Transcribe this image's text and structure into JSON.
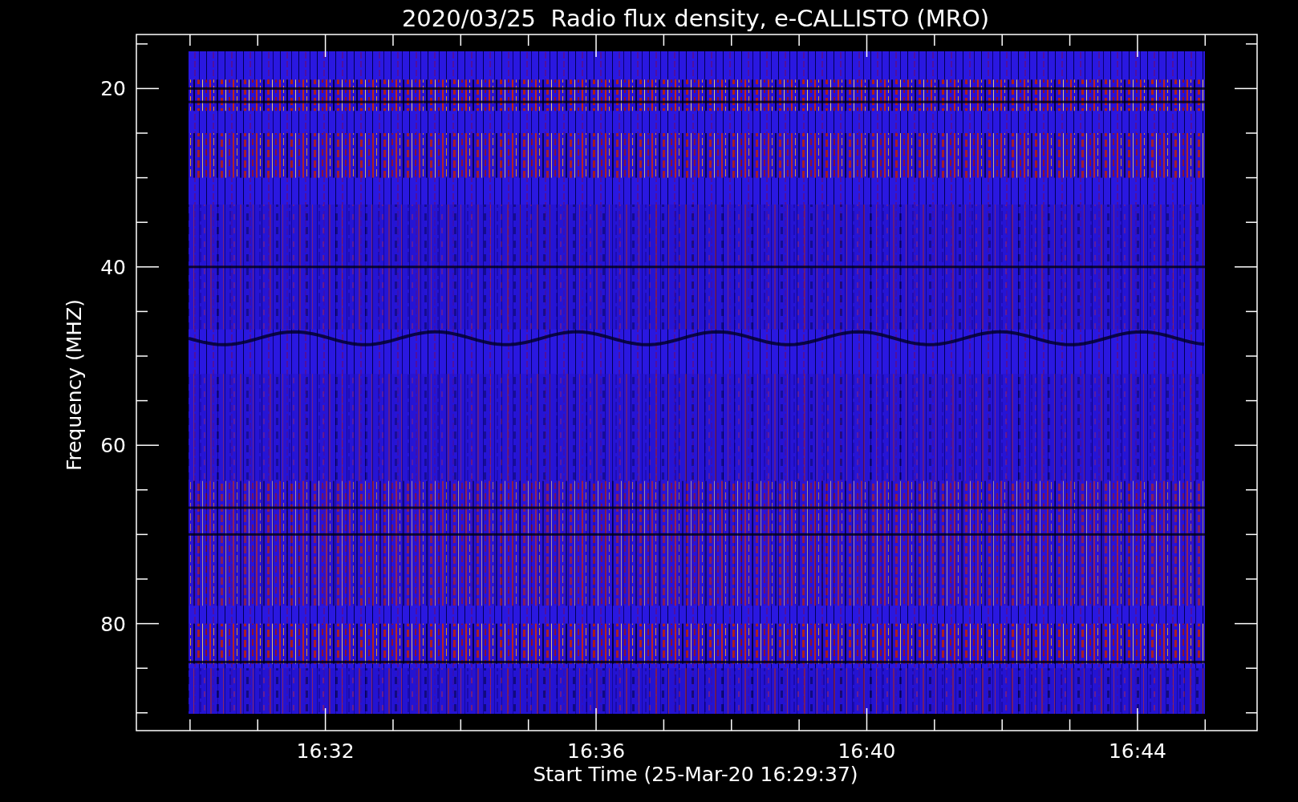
{
  "title": "2020/03/25  Radio flux density, e-CALLISTO (MRO)",
  "y_axis": {
    "label": "Frequency (MHZ)",
    "ticks": [
      "20",
      "40",
      "60",
      "80"
    ]
  },
  "x_axis": {
    "label": "Start Time (25-Mar-20 16:29:37)",
    "ticks": [
      "16:32",
      "16:36",
      "16:40",
      "16:44"
    ]
  }
}
